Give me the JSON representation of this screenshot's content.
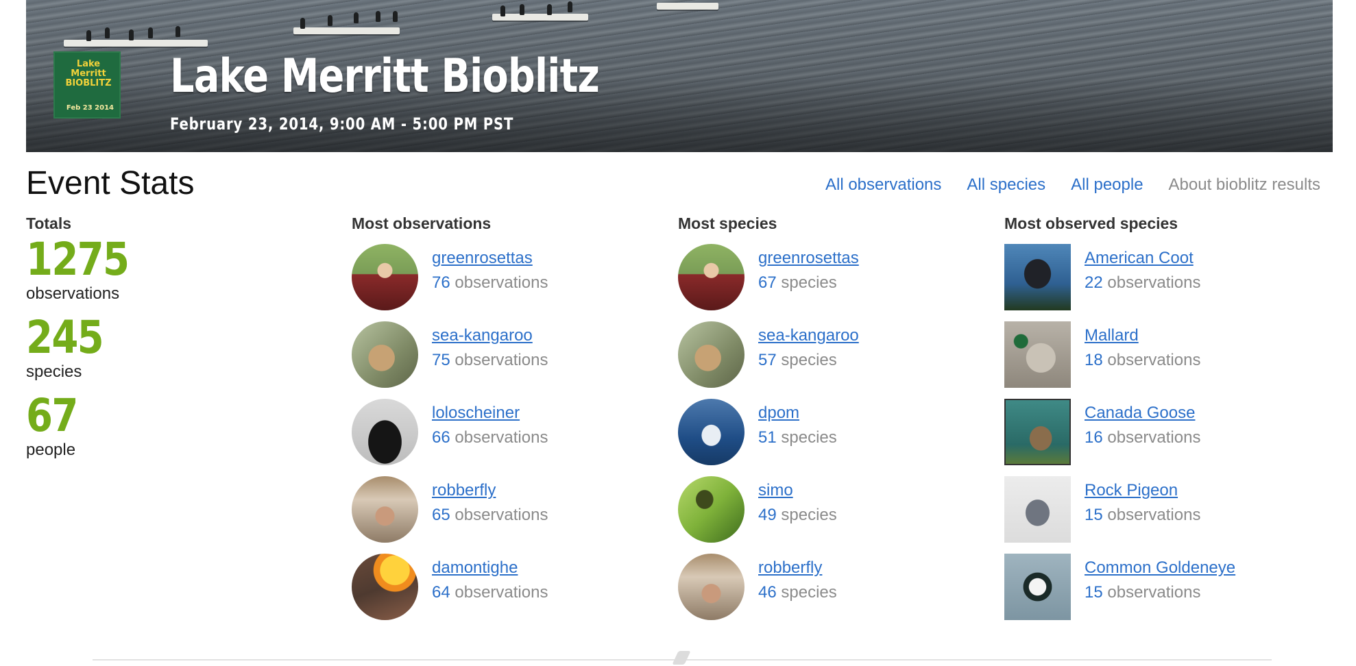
{
  "banner": {
    "title": "Lake Merritt Bioblitz",
    "date": "February 23, 2014, 9:00 AM - 5:00 PM PST",
    "logo": {
      "text": "Lake Merritt BIOBLITZ",
      "date": "Feb 23 2014"
    }
  },
  "header": {
    "title": "Event Stats",
    "links": [
      {
        "label": "All observations"
      },
      {
        "label": "All species"
      },
      {
        "label": "All people"
      },
      {
        "label": "About bioblitz results"
      }
    ]
  },
  "totals": {
    "heading": "Totals",
    "items": [
      {
        "value": "1275",
        "label": "observations"
      },
      {
        "value": "245",
        "label": "species"
      },
      {
        "value": "67",
        "label": "people"
      }
    ]
  },
  "most_observations": {
    "heading": "Most observations",
    "rows": [
      {
        "name": "greenrosettas",
        "count": "76",
        "unit": "observations"
      },
      {
        "name": "sea-kangaroo",
        "count": "75",
        "unit": "observations"
      },
      {
        "name": "loloscheiner",
        "count": "66",
        "unit": "observations"
      },
      {
        "name": "robberfly",
        "count": "65",
        "unit": "observations"
      },
      {
        "name": "damontighe",
        "count": "64",
        "unit": "observations"
      }
    ]
  },
  "most_species": {
    "heading": "Most species",
    "rows": [
      {
        "name": "greenrosettas",
        "count": "67",
        "unit": "species"
      },
      {
        "name": "sea-kangaroo",
        "count": "57",
        "unit": "species"
      },
      {
        "name": "dpom",
        "count": "51",
        "unit": "species"
      },
      {
        "name": "simo",
        "count": "49",
        "unit": "species"
      },
      {
        "name": "robberfly",
        "count": "46",
        "unit": "species"
      }
    ]
  },
  "most_observed_species": {
    "heading": "Most observed species",
    "rows": [
      {
        "name": "American Coot",
        "count": "22",
        "unit": "observations"
      },
      {
        "name": "Mallard",
        "count": "18",
        "unit": "observations"
      },
      {
        "name": "Canada Goose",
        "count": "16",
        "unit": "observations"
      },
      {
        "name": "Rock Pigeon",
        "count": "15",
        "unit": "observations"
      },
      {
        "name": "Common Goldeneye",
        "count": "15",
        "unit": "observations"
      }
    ]
  },
  "colors": {
    "link": "#2b6fc9",
    "muted": "#8a8a8a",
    "totals": "#74ac1a"
  }
}
